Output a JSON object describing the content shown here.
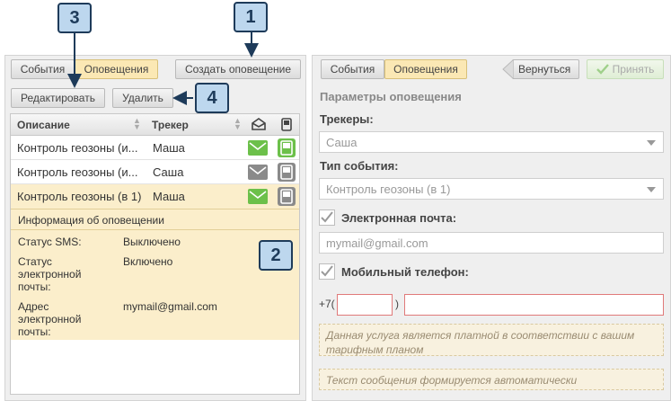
{
  "callouts": [
    "1",
    "2",
    "3",
    "4"
  ],
  "left": {
    "tabs": [
      "События",
      "Оповещения"
    ],
    "create_button": "Создать оповещение",
    "edit_button": "Редактировать",
    "delete_button": "Удалить",
    "columns": {
      "description": "Описание",
      "tracker": "Трекер"
    },
    "rows": [
      {
        "description": "Контроль геозоны (и...",
        "tracker": "Маша",
        "email": "on",
        "phone": "on"
      },
      {
        "description": "Контроль геозоны (и...",
        "tracker": "Саша",
        "email": "off",
        "phone": "off"
      },
      {
        "description": "Контроль геозоны (в 1)",
        "tracker": "Маша",
        "email": "on",
        "phone": "off"
      }
    ],
    "info": {
      "title": "Информация об оповещении",
      "items": [
        {
          "label": "Статус SMS:",
          "value": "Выключено"
        },
        {
          "label": "Статус электронной почты:",
          "value": "Включено"
        },
        {
          "label": "Адрес электронной почты:",
          "value": "mymail@gmail.com"
        }
      ]
    }
  },
  "right": {
    "tabs": [
      "События",
      "Оповещения"
    ],
    "back_button": "Вернуться",
    "accept_button": "Принять",
    "section_title": "Параметры оповещения",
    "trackers_label": "Трекеры:",
    "trackers_value": "Саша",
    "event_type_label": "Тип события:",
    "event_type_value": "Контроль геозоны (в 1)",
    "email_label": "Электронная почта:",
    "email_value": "mymail@gmail.com",
    "mobile_label": "Мобильный телефон:",
    "phone_prefix": "+7(",
    "phone_paren": ")",
    "paid_note": "Данная услуга является платной в соответствии с вашим тарифным планом",
    "auto_note": "Текст сообщения формируется автоматически"
  },
  "colors": {
    "green": "#6cc04a",
    "gray_icon": "#8a8a8a",
    "callout_fill": "#bdd7ee",
    "callout_border": "#1e3b5a",
    "highlight": "#fbeecb"
  },
  "icons": [
    "envelope-open-icon",
    "phone-icon",
    "envelope-icon",
    "checkmark-icon",
    "back-arrow-icon",
    "sort-icon",
    "dropdown-arrow-icon"
  ]
}
